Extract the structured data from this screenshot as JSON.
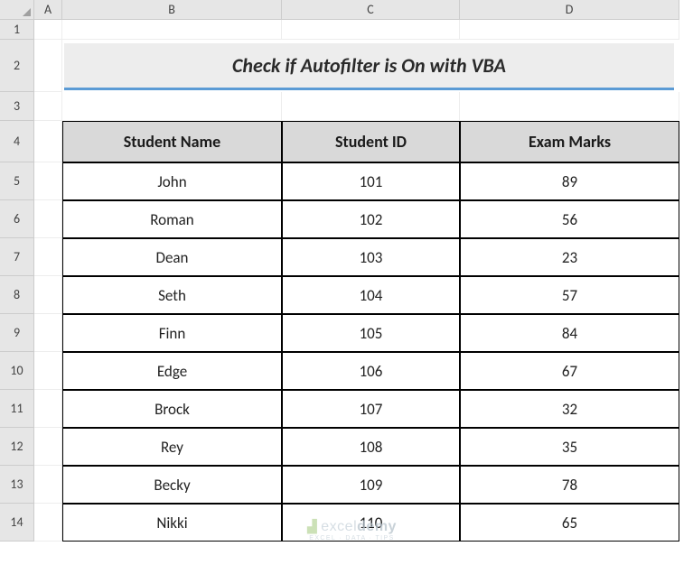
{
  "columns": [
    "A",
    "B",
    "C",
    "D"
  ],
  "rows": [
    "1",
    "2",
    "3",
    "4",
    "5",
    "6",
    "7",
    "8",
    "9",
    "10",
    "11",
    "12",
    "13",
    "14"
  ],
  "title": "Check if Autofilter is On with VBA",
  "headers": {
    "name": "Student Name",
    "id": "Student ID",
    "marks": "Exam Marks"
  },
  "data": [
    {
      "name": "John",
      "id": "101",
      "marks": "89"
    },
    {
      "name": "Roman",
      "id": "102",
      "marks": "56"
    },
    {
      "name": "Dean",
      "id": "103",
      "marks": "23"
    },
    {
      "name": "Seth",
      "id": "104",
      "marks": "57"
    },
    {
      "name": "Finn",
      "id": "105",
      "marks": "84"
    },
    {
      "name": "Edge",
      "id": "106",
      "marks": "67"
    },
    {
      "name": "Brock",
      "id": "107",
      "marks": "32"
    },
    {
      "name": "Rey",
      "id": "108",
      "marks": "35"
    },
    {
      "name": "Becky",
      "id": "109",
      "marks": "78"
    },
    {
      "name": "Nikki",
      "id": "110",
      "marks": "65"
    }
  ],
  "watermark": {
    "brand_prefix": "excel",
    "brand_suffix": "demy",
    "tagline": "EXCEL · DATA · TIPS"
  },
  "chart_data": {
    "type": "table",
    "title": "Check if Autofilter is On with VBA",
    "columns": [
      "Student Name",
      "Student ID",
      "Exam Marks"
    ],
    "rows": [
      [
        "John",
        101,
        89
      ],
      [
        "Roman",
        102,
        56
      ],
      [
        "Dean",
        103,
        23
      ],
      [
        "Seth",
        104,
        57
      ],
      [
        "Finn",
        105,
        84
      ],
      [
        "Edge",
        106,
        67
      ],
      [
        "Brock",
        107,
        32
      ],
      [
        "Rey",
        108,
        35
      ],
      [
        "Becky",
        109,
        78
      ],
      [
        "Nikki",
        110,
        65
      ]
    ]
  }
}
